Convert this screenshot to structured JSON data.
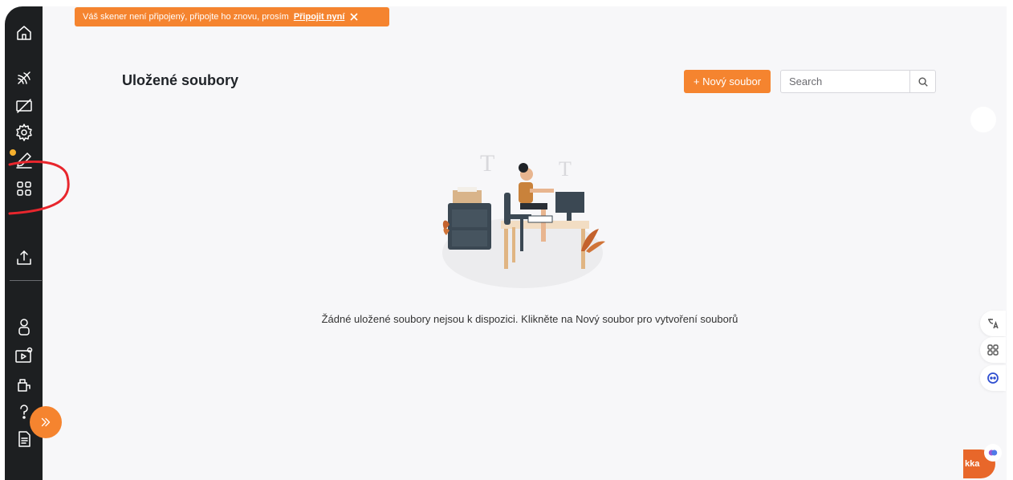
{
  "banner": {
    "message": "Váš skener není připojený, připojte ho znovu, prosím",
    "link": "Připojit nyní"
  },
  "header": {
    "title": "Uložené soubory",
    "new_button": "+ Nový soubor",
    "search_placeholder": "Search"
  },
  "empty_state": {
    "message": "Žádné uložené soubory nejsou k dispozici. Klikněte na Nový soubor pro vytvoření souborů"
  },
  "sidebar": {
    "icons": [
      "home-icon",
      "no-signal-icon",
      "no-screen-icon",
      "settings-icon",
      "pen-icon",
      "apps-grid-icon",
      "upload-icon",
      "user-icon",
      "video-settings-icon",
      "tools-icon",
      "help-icon",
      "document-icon"
    ]
  },
  "assistant": {
    "label": "kka"
  },
  "colors": {
    "accent": "#f5842f",
    "sidebar": "#1d1f21",
    "background": "#f7f7f9"
  }
}
